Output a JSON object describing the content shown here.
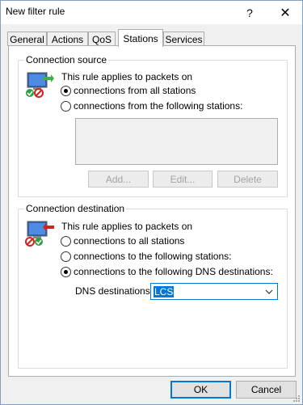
{
  "window": {
    "title": "New filter rule",
    "help_glyph": "?",
    "close_glyph": "✕"
  },
  "tabs": [
    {
      "label": "General"
    },
    {
      "label": "Actions"
    },
    {
      "label": "QoS"
    },
    {
      "label": "Stations",
      "active": true
    },
    {
      "label": "Services"
    }
  ],
  "source": {
    "group_label": "Connection source",
    "intro": "This rule applies to packets on",
    "options": [
      {
        "label": "connections from all stations",
        "checked": true
      },
      {
        "label": "connections from the following stations:",
        "checked": false
      }
    ],
    "buttons": {
      "add": "Add...",
      "edit": "Edit...",
      "delete": "Delete"
    }
  },
  "destination": {
    "group_label": "Connection destination",
    "intro": "This rule applies to packets on",
    "options": [
      {
        "label": "connections to all stations",
        "checked": false
      },
      {
        "label": "connections to the following stations:",
        "checked": false
      },
      {
        "label": "connections to the following DNS destinations:",
        "checked": true
      }
    ],
    "dns_label": "DNS destinations:",
    "dns_value": "LCS"
  },
  "footer": {
    "ok": "OK",
    "cancel": "Cancel"
  },
  "colors": {
    "accent": "#0078d7",
    "dialog_bg": "#f0f0f0",
    "disabled_text": "#a3a3a3"
  }
}
